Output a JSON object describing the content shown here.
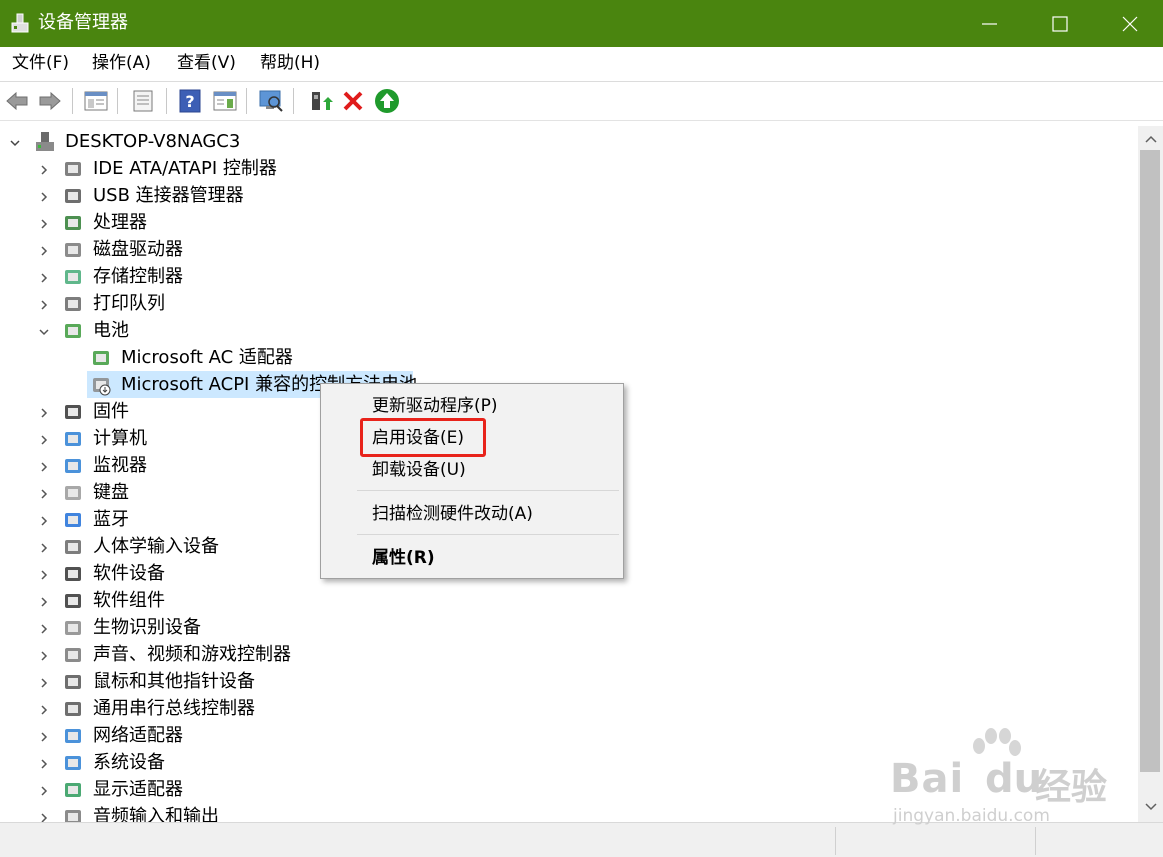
{
  "window": {
    "title": "设备管理器"
  },
  "menu": [
    "文件(F)",
    "操作(A)",
    "查看(V)",
    "帮助(H)"
  ],
  "tree": {
    "root": "DESKTOP-V8NAGC3",
    "categories": [
      {
        "label": "IDE ATA/ATAPI 控制器",
        "icon": "ide-controller-icon"
      },
      {
        "label": "USB 连接器管理器",
        "icon": "usb-icon"
      },
      {
        "label": "处理器",
        "icon": "processor-icon"
      },
      {
        "label": "磁盘驱动器",
        "icon": "disk-drive-icon"
      },
      {
        "label": "存储控制器",
        "icon": "storage-controller-icon"
      },
      {
        "label": "打印队列",
        "icon": "printer-icon"
      },
      {
        "label": "电池",
        "icon": "battery-icon"
      },
      {
        "label": "Microsoft AC 适配器",
        "icon": "battery-icon"
      },
      {
        "label": "Microsoft ACPI 兼容的控制方法电池",
        "icon": "battery-disabled-icon"
      },
      {
        "label": "固件",
        "icon": "firmware-icon"
      },
      {
        "label": "计算机",
        "icon": "computer-icon"
      },
      {
        "label": "监视器",
        "icon": "monitor-icon"
      },
      {
        "label": "键盘",
        "icon": "keyboard-icon"
      },
      {
        "label": "蓝牙",
        "icon": "bluetooth-icon"
      },
      {
        "label": "人体学输入设备",
        "icon": "hid-icon"
      },
      {
        "label": "软件设备",
        "icon": "software-device-icon"
      },
      {
        "label": "软件组件",
        "icon": "software-component-icon"
      },
      {
        "label": "生物识别设备",
        "icon": "fingerprint-icon"
      },
      {
        "label": "声音、视频和游戏控制器",
        "icon": "speaker-icon"
      },
      {
        "label": "鼠标和其他指针设备",
        "icon": "mouse-icon"
      },
      {
        "label": "通用串行总线控制器",
        "icon": "usb-controller-icon"
      },
      {
        "label": "网络适配器",
        "icon": "network-adapter-icon"
      },
      {
        "label": "系统设备",
        "icon": "system-device-icon"
      },
      {
        "label": "显示适配器",
        "icon": "display-adapter-icon"
      },
      {
        "label": "音频输入和输出",
        "icon": "audio-io-icon"
      }
    ]
  },
  "context_menu": {
    "update_driver": "更新驱动程序(P)",
    "enable_device": "启用设备(E)",
    "uninstall_device": "卸载设备(U)",
    "scan_hardware": "扫描检测硬件改动(A)",
    "properties": "属性(R)"
  },
  "watermark": {
    "logo_left": "Bai",
    "logo_right": "du",
    "brand": "经验",
    "url": "jingyan.baidu.com"
  },
  "colors": {
    "titlebar": "#4a850f",
    "selection": "#cce8ff",
    "highlight": "#e8231b"
  }
}
